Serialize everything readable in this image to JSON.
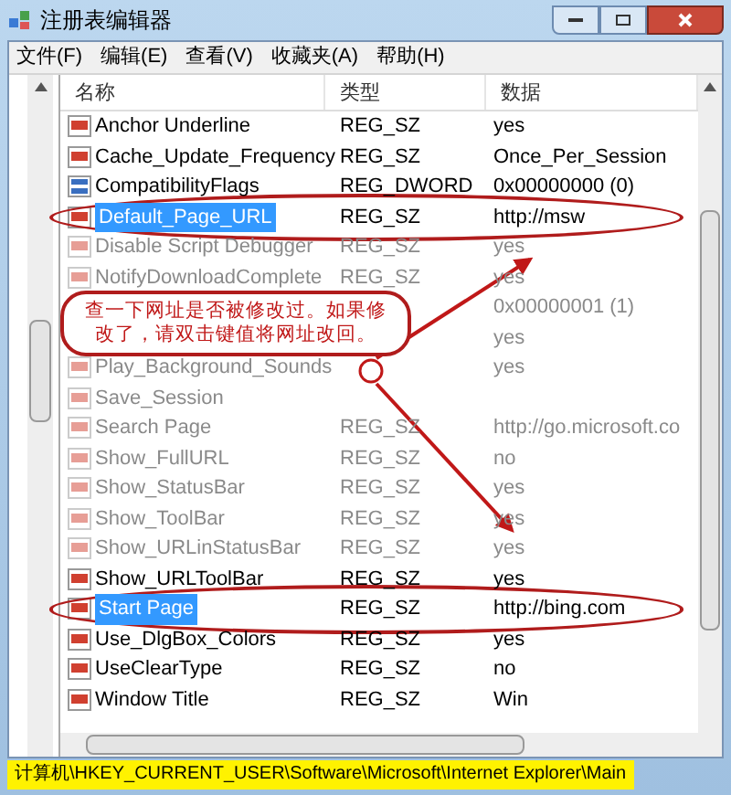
{
  "window": {
    "title": "注册表编辑器"
  },
  "menu": [
    "文件(F)",
    "编辑(E)",
    "查看(V)",
    "收藏夹(A)",
    "帮助(H)"
  ],
  "columns": [
    "名称",
    "类型",
    "数据"
  ],
  "rows": [
    {
      "kind": "string",
      "name": "Anchor Underline",
      "type": "REG_SZ",
      "data": "yes",
      "selected": false,
      "faded": false
    },
    {
      "kind": "string",
      "name": "Cache_Update_Frequency",
      "type": "REG_SZ",
      "data": "Once_Per_Session",
      "selected": false,
      "faded": false
    },
    {
      "kind": "binary",
      "name": "CompatibilityFlags",
      "type": "REG_DWORD",
      "data": "0x00000000 (0)",
      "selected": false,
      "faded": false
    },
    {
      "kind": "string",
      "name": "Default_Page_URL",
      "type": "REG_SZ",
      "data": "http://msw",
      "selected": true,
      "faded": false,
      "circled": true
    },
    {
      "kind": "string",
      "name": "Disable Script Debugger",
      "type": "REG_SZ",
      "data": "yes",
      "selected": false,
      "faded": true
    },
    {
      "kind": "string",
      "name": "NotifyDownloadComplete",
      "type": "REG_SZ",
      "data": "yes",
      "selected": false,
      "faded": true
    },
    {
      "kind": "hidden",
      "data": "0x00000001 (1)",
      "selected": false,
      "faded": true
    },
    {
      "kind": "hidden",
      "data": "yes",
      "selected": false,
      "faded": true
    },
    {
      "kind": "string",
      "name": "Play_Background_Sounds",
      "data": "yes",
      "selected": false,
      "faded": true
    },
    {
      "kind": "string",
      "name": "Save_Session",
      "selected": false,
      "faded": true
    },
    {
      "kind": "string",
      "name": "Search Page",
      "type": "REG_SZ",
      "data": "http://go.microsoft.co",
      "selected": false,
      "faded": true
    },
    {
      "kind": "string",
      "name": "Show_FullURL",
      "type": "REG_SZ",
      "data": "no",
      "selected": false,
      "faded": true
    },
    {
      "kind": "string",
      "name": "Show_StatusBar",
      "type": "REG_SZ",
      "data": "yes",
      "selected": false,
      "faded": true
    },
    {
      "kind": "string",
      "name": "Show_ToolBar",
      "type": "REG_SZ",
      "data": "yes",
      "selected": false,
      "faded": true
    },
    {
      "kind": "string",
      "name": "Show_URLinStatusBar",
      "type": "REG_SZ",
      "data": "yes",
      "selected": false,
      "faded": true
    },
    {
      "kind": "string",
      "name": "Show_URLToolBar",
      "type": "REG_SZ",
      "data": "yes",
      "selected": false,
      "faded": false
    },
    {
      "kind": "string",
      "name": "Start Page",
      "type": "REG_SZ",
      "data": "http://bing.com",
      "selected": true,
      "faded": false,
      "circled": true
    },
    {
      "kind": "string",
      "name": "Use_DlgBox_Colors",
      "type": "REG_SZ",
      "data": "yes",
      "selected": false,
      "faded": false
    },
    {
      "kind": "string",
      "name": "UseClearType",
      "type": "REG_SZ",
      "data": "no",
      "selected": false,
      "faded": false
    },
    {
      "kind": "string",
      "name": "Window Title",
      "type": "REG_SZ",
      "data": "Win",
      "selected": false,
      "faded": false
    }
  ],
  "callout": {
    "text": "查一下网址是否被修改过。如果修改了，请双击键值将网址改回。"
  },
  "status_bar": "计算机\\HKEY_CURRENT_USER\\Software\\Microsoft\\Internet Explorer\\Main"
}
